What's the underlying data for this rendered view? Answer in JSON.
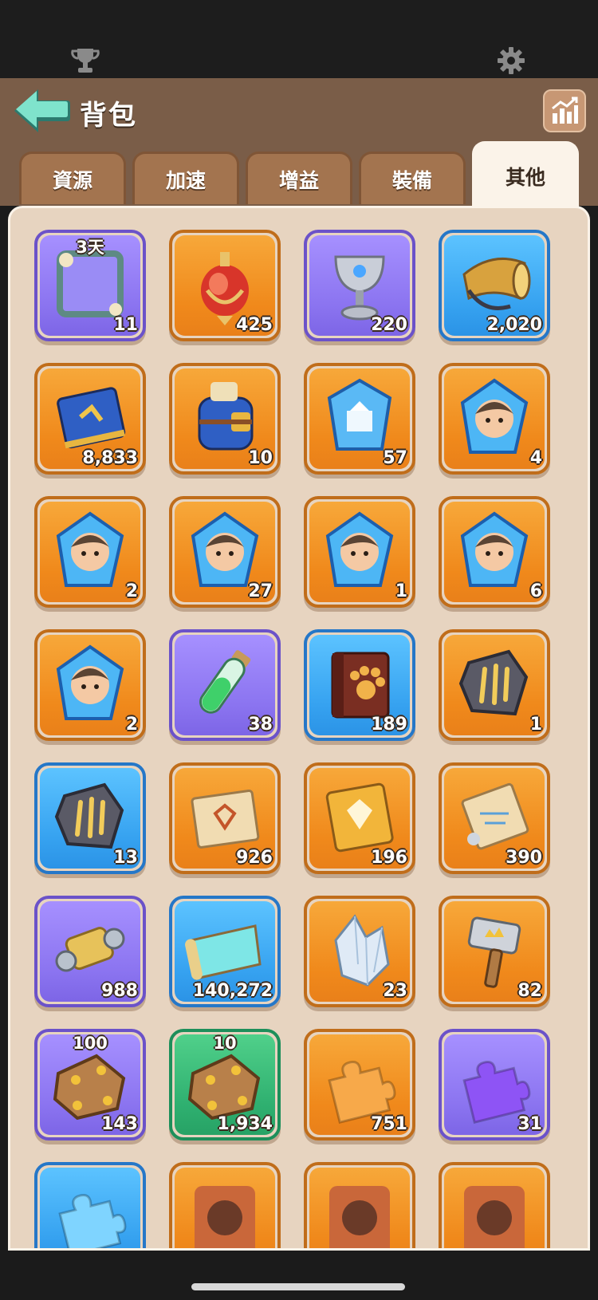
{
  "header": {
    "title": "背包",
    "trophy_icon": "trophy-icon",
    "settings_icon": "gear-icon",
    "back_icon": "arrow-left-icon",
    "stats_icon": "bar-chart-icon"
  },
  "tabs": [
    {
      "label": "資源",
      "active": false
    },
    {
      "label": "加速",
      "active": false
    },
    {
      "label": "增益",
      "active": false
    },
    {
      "label": "裝備",
      "active": false
    },
    {
      "label": "其他",
      "active": true
    }
  ],
  "items": [
    {
      "name": "avatar-frame",
      "icon": "frame-icon",
      "rarity": "purple",
      "count": "11",
      "tag": "3天"
    },
    {
      "name": "potion-flask",
      "icon": "flask-icon",
      "rarity": "orange",
      "count": "425",
      "tag": ""
    },
    {
      "name": "silver-chalice",
      "icon": "chalice-icon",
      "rarity": "purple",
      "count": "220",
      "tag": ""
    },
    {
      "name": "war-horn",
      "icon": "horn-icon",
      "rarity": "blue",
      "count": "2,020",
      "tag": ""
    },
    {
      "name": "skill-book",
      "icon": "book-icon",
      "rarity": "orange",
      "count": "8,833",
      "tag": ""
    },
    {
      "name": "backpack",
      "icon": "backpack-icon",
      "rarity": "orange",
      "count": "10",
      "tag": ""
    },
    {
      "name": "hero-crest",
      "icon": "crest-icon",
      "rarity": "orange",
      "count": "57",
      "tag": ""
    },
    {
      "name": "hero-shard-woman",
      "icon": "hero-shard-icon",
      "rarity": "orange",
      "count": "4",
      "tag": ""
    },
    {
      "name": "hero-shard-old-man",
      "icon": "hero-shard-icon",
      "rarity": "orange",
      "count": "2",
      "tag": ""
    },
    {
      "name": "hero-shard-dwarf",
      "icon": "hero-shard-icon",
      "rarity": "orange",
      "count": "27",
      "tag": ""
    },
    {
      "name": "hero-shard-silver-hair",
      "icon": "hero-shard-icon",
      "rarity": "orange",
      "count": "1",
      "tag": ""
    },
    {
      "name": "hero-shard-princess",
      "icon": "hero-shard-icon",
      "rarity": "orange",
      "count": "6",
      "tag": ""
    },
    {
      "name": "hero-shard-captain",
      "icon": "hero-shard-icon",
      "rarity": "orange",
      "count": "2",
      "tag": ""
    },
    {
      "name": "green-potion",
      "icon": "test-tube-icon",
      "rarity": "purple",
      "count": "38",
      "tag": ""
    },
    {
      "name": "pet-book",
      "icon": "paw-book-icon",
      "rarity": "blue",
      "count": "189",
      "tag": ""
    },
    {
      "name": "claw-stone-gold",
      "icon": "claw-stone-icon",
      "rarity": "orange",
      "count": "1",
      "tag": ""
    },
    {
      "name": "claw-stone-silver",
      "icon": "claw-stone-icon",
      "rarity": "blue",
      "count": "13",
      "tag": ""
    },
    {
      "name": "gem-scroll",
      "icon": "scroll-icon",
      "rarity": "orange",
      "count": "926",
      "tag": ""
    },
    {
      "name": "gem-book",
      "icon": "gold-book-icon",
      "rarity": "orange",
      "count": "196",
      "tag": ""
    },
    {
      "name": "blueprint-scroll",
      "icon": "blueprint-icon",
      "rarity": "orange",
      "count": "390",
      "tag": ""
    },
    {
      "name": "gold-thread",
      "icon": "spool-icon",
      "rarity": "purple",
      "count": "988",
      "tag": ""
    },
    {
      "name": "cyan-scroll",
      "icon": "map-icon",
      "rarity": "blue",
      "count": "140,272",
      "tag": ""
    },
    {
      "name": "crystal-ore",
      "icon": "crystal-icon",
      "rarity": "orange",
      "count": "23",
      "tag": ""
    },
    {
      "name": "crown-hammer",
      "icon": "hammer-icon",
      "rarity": "orange",
      "count": "82",
      "tag": ""
    },
    {
      "name": "leather-100",
      "icon": "leather-icon",
      "rarity": "purple",
      "count": "143",
      "tag": "100"
    },
    {
      "name": "leather-10",
      "icon": "leather-icon",
      "rarity": "green",
      "count": "1,934",
      "tag": "10"
    },
    {
      "name": "puzzle-orange",
      "icon": "puzzle-icon",
      "rarity": "orange",
      "count": "751",
      "tag": ""
    },
    {
      "name": "puzzle-purple",
      "icon": "puzzle-icon",
      "rarity": "purple",
      "count": "31",
      "tag": ""
    },
    {
      "name": "partial-blue",
      "icon": "puzzle-icon",
      "rarity": "blue",
      "count": "",
      "tag": ""
    },
    {
      "name": "partial-orange-1",
      "icon": "portrait-icon",
      "rarity": "orange",
      "count": "",
      "tag": ""
    },
    {
      "name": "partial-orange-2",
      "icon": "portrait-icon",
      "rarity": "orange",
      "count": "",
      "tag": ""
    },
    {
      "name": "partial-orange-3",
      "icon": "portrait-icon",
      "rarity": "orange",
      "count": "",
      "tag": ""
    }
  ]
}
